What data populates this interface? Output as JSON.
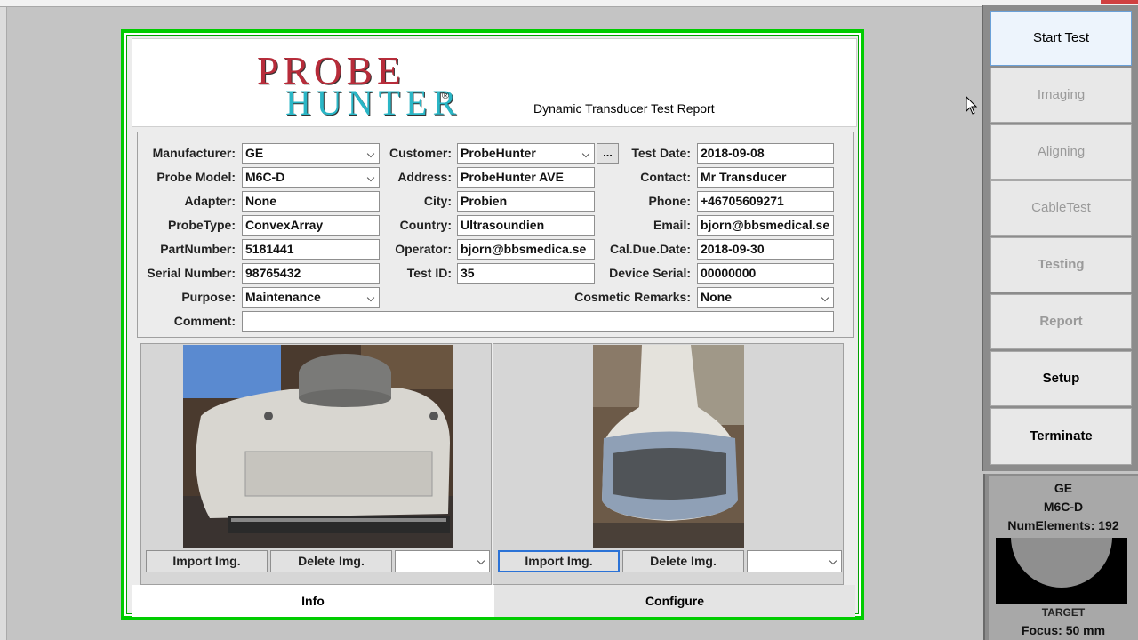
{
  "report": {
    "logo_line1": "PROBE",
    "logo_line2": "HUNTER",
    "logo_reg": "®",
    "title": "Dynamic Transducer Test Report"
  },
  "form": {
    "manufacturer": {
      "label": "Manufacturer:",
      "value": "GE"
    },
    "probe_model": {
      "label": "Probe Model:",
      "value": "M6C-D"
    },
    "adapter": {
      "label": "Adapter:",
      "value": "None"
    },
    "probe_type": {
      "label": "ProbeType:",
      "value": "ConvexArray"
    },
    "part_number": {
      "label": "PartNumber:",
      "value": "5181441"
    },
    "serial_number": {
      "label": "Serial Number:",
      "value": "98765432"
    },
    "purpose": {
      "label": "Purpose:",
      "value": "Maintenance"
    },
    "comment": {
      "label": "Comment:",
      "value": ""
    },
    "customer": {
      "label": "Customer:",
      "value": "ProbeHunter",
      "browse": "..."
    },
    "address": {
      "label": "Address:",
      "value": "ProbeHunter AVE"
    },
    "city": {
      "label": "City:",
      "value": "Probien"
    },
    "country": {
      "label": "Country:",
      "value": "Ultrasoundien"
    },
    "operator": {
      "label": "Operator:",
      "value": "bjorn@bbsmedica.se"
    },
    "test_id": {
      "label": "Test ID:",
      "value": "35"
    },
    "test_date": {
      "label": "Test Date:",
      "value": "2018-09-08"
    },
    "contact": {
      "label": "Contact:",
      "value": "Mr Transducer"
    },
    "phone": {
      "label": "Phone:",
      "value": "+46705609271"
    },
    "email": {
      "label": "Email:",
      "value": "bjorn@bbsmedical.se"
    },
    "cal_due_date": {
      "label": "Cal.Due.Date:",
      "value": "2018-09-30"
    },
    "device_serial": {
      "label": "Device Serial:",
      "value": "00000000"
    },
    "cosmetic_remarks": {
      "label": "Cosmetic Remarks:",
      "value": "None"
    }
  },
  "images": {
    "import_label": "Import Img.",
    "delete_label": "Delete Img."
  },
  "tabs": {
    "info": "Info",
    "configure": "Configure"
  },
  "sidebar": {
    "start_test": "Start Test",
    "imaging": "Imaging",
    "aligning": "Aligning",
    "cable_test": "CableTest",
    "testing": "Testing",
    "report": "Report",
    "setup": "Setup",
    "terminate": "Terminate"
  },
  "probe_info": {
    "manufacturer": "GE",
    "model": "M6C-D",
    "num_elements": "NumElements: 192",
    "target": "TARGET",
    "focus": "Focus: 50 mm"
  },
  "colors": {
    "frame": "#00cc00",
    "logo_red": "#b72c3a",
    "logo_cyan": "#2ab6c6"
  }
}
